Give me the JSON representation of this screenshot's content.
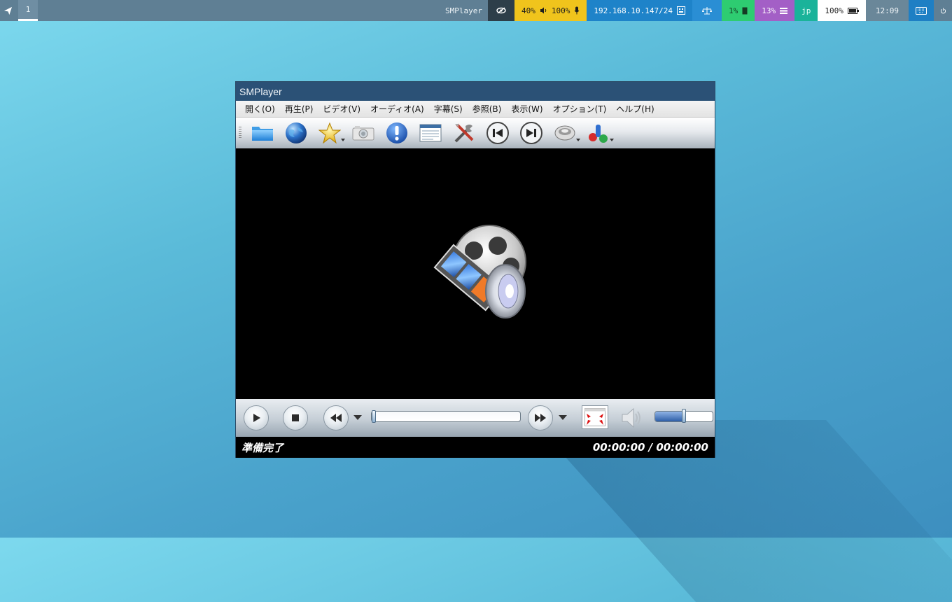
{
  "topbar": {
    "workspace": "1",
    "window_title": "SMPlayer",
    "audio": {
      "volume": "40%",
      "mic": "100%"
    },
    "network": "192.168.10.147/24",
    "cpu": "1%",
    "memory": "13%",
    "keyboard_layout": "jp",
    "battery": "100%",
    "clock": "12:09",
    "icons": [
      "send-icon",
      "eye-icon",
      "speaker-icon",
      "microphone-icon",
      "ethernet-icon",
      "balance-icon",
      "cpu-icon",
      "memory-icon",
      "battery-icon",
      "keyboard-icon",
      "power-icon"
    ],
    "colors": {
      "bar": "#5f7f94",
      "audio": "#f0c41c",
      "net": "#1e83c9",
      "cpu": "#2ecc71",
      "mem": "#a35fc6",
      "lang": "#1ab39a"
    }
  },
  "window": {
    "title": "SMPlayer",
    "menu": [
      "開く(O)",
      "再生(P)",
      "ビデオ(V)",
      "オーディオ(A)",
      "字幕(S)",
      "参照(B)",
      "表示(W)",
      "オプション(T)",
      "ヘルプ(H)"
    ],
    "toolbar": [
      "open-folder-icon",
      "open-url-icon",
      "favorites-icon",
      "screenshot-icon",
      "info-icon",
      "playlist-icon",
      "preferences-icon",
      "previous-icon",
      "next-icon",
      "audio-track-icon",
      "subtitles-icon"
    ],
    "controls": {
      "buttons": [
        "play-icon",
        "stop-icon",
        "rewind-icon",
        "forward-icon",
        "fullscreen-icon",
        "volume-icon"
      ],
      "seek_position": 0,
      "volume_level": 0.5
    },
    "status": {
      "message": "準備完了",
      "time": "00:00:00 / 00:00:00"
    }
  }
}
